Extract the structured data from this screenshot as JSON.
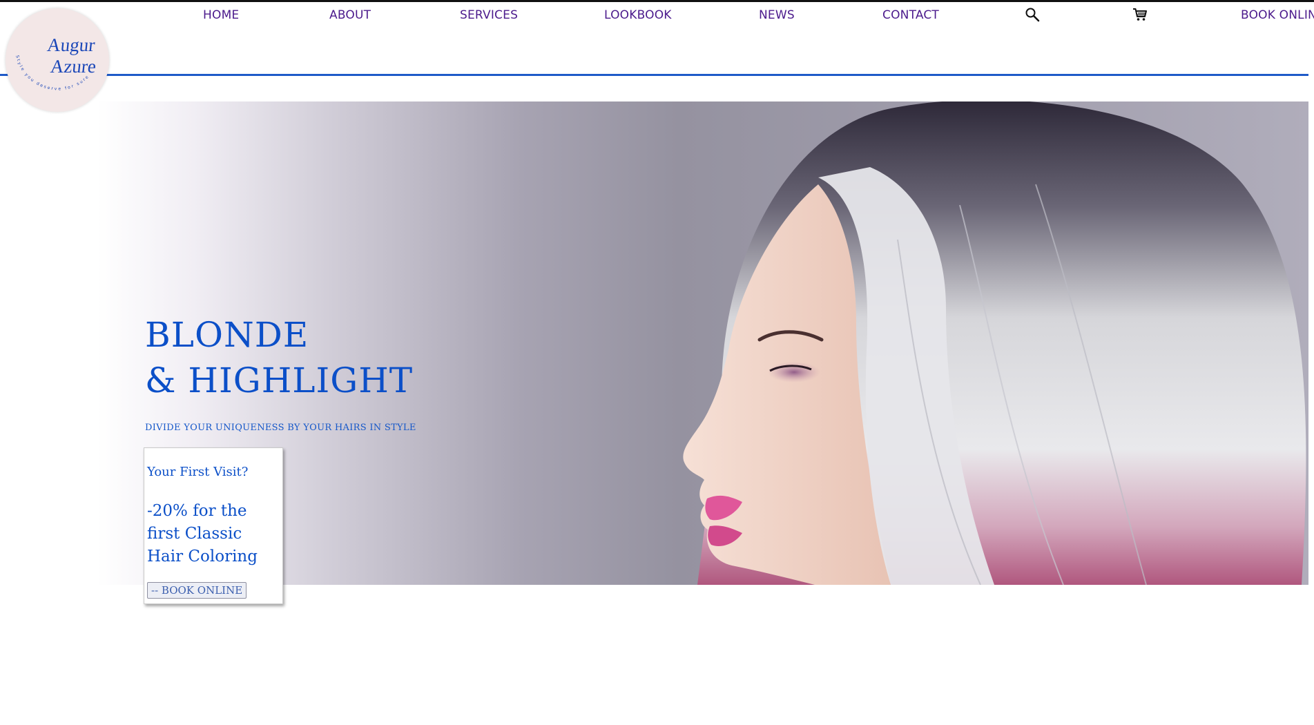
{
  "logo": {
    "name_line1": "Augur",
    "name_line2": "Azure",
    "tagline": "Style you deserve for sure"
  },
  "nav": {
    "items": [
      {
        "label": "HOME"
      },
      {
        "label": "ABOUT"
      },
      {
        "label": "SERVICES"
      },
      {
        "label": "LOOKBOOK"
      },
      {
        "label": "NEWS"
      },
      {
        "label": "CONTACT"
      }
    ],
    "search_icon": "search-icon",
    "cart_icon": "cart-icon",
    "book_online": "BOOK ONLINE"
  },
  "hero": {
    "title_line1": "BLONDE",
    "title_line2": "& HIGHLIGHT",
    "subtitle": "DIVIDE YOUR UNIQUENESS BY YOUR HAIRS IN STYLE",
    "image": "woman-silver-bob-hair-profile"
  },
  "promo": {
    "question": "Your First Visit?",
    "offer": "-20% for the first Classic Hair Coloring",
    "button_label": "-- BOOK ONLINE"
  },
  "colors": {
    "accent_blue": "#0b4fc8",
    "nav_purple": "#4b1a8c",
    "header_line": "#1e5ac8",
    "logo_bg": "#f3e7e7"
  }
}
